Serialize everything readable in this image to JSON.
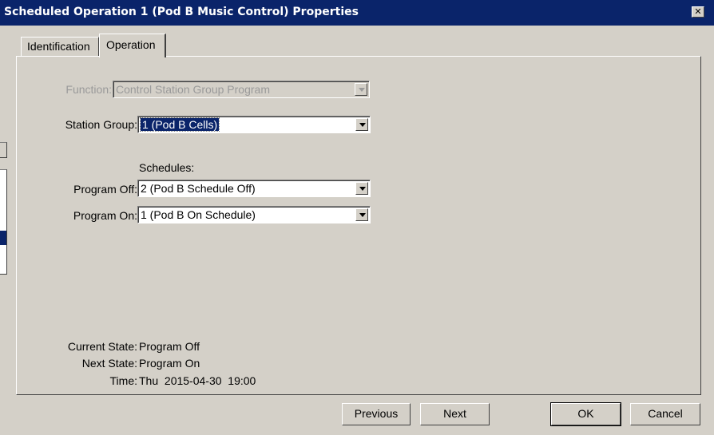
{
  "window": {
    "title": "Scheduled Operation 1 (Pod B Music Control) Properties",
    "close_glyph": "✕"
  },
  "tabs": [
    {
      "label": "Identification",
      "active": false
    },
    {
      "label": "Operation",
      "active": true
    }
  ],
  "form": {
    "function": {
      "label": "Function:",
      "value": "Control Station Group Program",
      "disabled": true
    },
    "station_group": {
      "label": "Station Group:",
      "value": "1 (Pod B Cells)"
    },
    "schedules_heading": "Schedules:",
    "program_off": {
      "label": "Program Off:",
      "value": "2 (Pod B Schedule Off)"
    },
    "program_on": {
      "label": "Program On:",
      "value": "1 (Pod B On Schedule)"
    }
  },
  "status": {
    "current_state": {
      "label": "Current State:",
      "value": "Program Off"
    },
    "next_state": {
      "label": "Next State:",
      "value": "Program On"
    },
    "time": {
      "label": "Time:",
      "value": "Thu  2015-04-30  19:00"
    }
  },
  "buttons": {
    "previous": "Previous",
    "next": "Next",
    "ok": "OK",
    "cancel": "Cancel"
  },
  "colors": {
    "titlebar": "#0a246a",
    "dialog_bg": "#d4d0c8",
    "selection": "#0a246a"
  }
}
